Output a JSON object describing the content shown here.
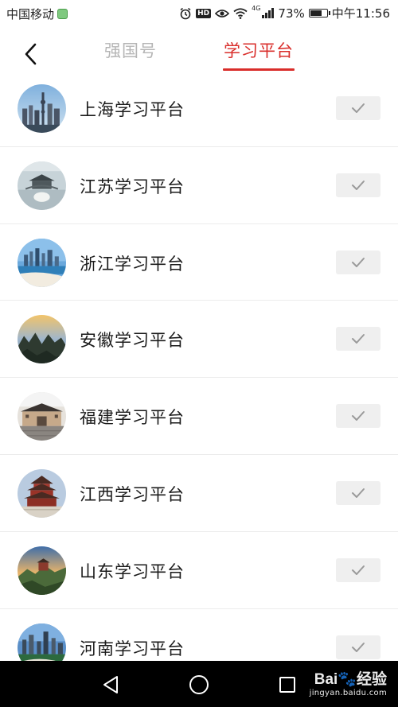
{
  "status_bar": {
    "carrier": "中国移动",
    "network": "4G",
    "battery": "73%",
    "battery_level": 0.73,
    "time": "中午11:56",
    "icons": [
      "alarm-icon",
      "hd-icon",
      "eye-icon",
      "wifi-icon",
      "signal-icon",
      "battery-icon"
    ]
  },
  "header": {
    "back_icon": "chevron-left-icon",
    "tabs": [
      {
        "label": "强国号",
        "active": false
      },
      {
        "label": "学习平台",
        "active": true
      }
    ],
    "accent_color": "#d92d2a"
  },
  "platforms": [
    {
      "name": "上海学习平台",
      "avatar": "shanghai-skyline-image",
      "checked": true
    },
    {
      "name": "江苏学习平台",
      "avatar": "jiangsu-pavilion-image",
      "checked": true
    },
    {
      "name": "浙江学习平台",
      "avatar": "zhejiang-coast-image",
      "checked": true
    },
    {
      "name": "安徽学习平台",
      "avatar": "anhui-mountain-image",
      "checked": true
    },
    {
      "name": "福建学习平台",
      "avatar": "fujian-tulou-image",
      "checked": true
    },
    {
      "name": "江西学习平台",
      "avatar": "jiangxi-tower-image",
      "checked": true
    },
    {
      "name": "山东学习平台",
      "avatar": "shandong-mountain-image",
      "checked": true
    },
    {
      "name": "河南学习平台",
      "avatar": "henan-city-image",
      "checked": true
    }
  ],
  "nav_bar": {
    "buttons": [
      "back-triangle-icon",
      "home-circle-icon",
      "recents-square-icon"
    ],
    "watermark_brand": "Bai",
    "watermark_brand_suffix": "经验",
    "watermark_url": "jingyan.baidu.com"
  }
}
